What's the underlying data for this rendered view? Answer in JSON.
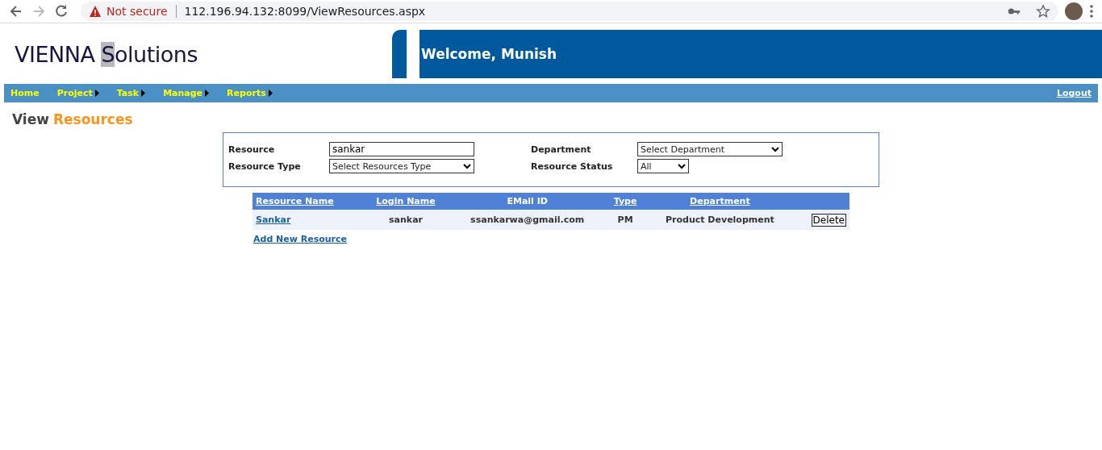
{
  "browser": {
    "security": "Not secure",
    "url": "112.196.94.132:8099/ViewResources.aspx",
    "forward_disabled": true
  },
  "logo": {
    "before": "VIENNA ",
    "marked": "S",
    "after": "olutions"
  },
  "welcome": "Welcome, Munish",
  "nav": [
    {
      "label": "Home",
      "has_submenu": false
    },
    {
      "label": "Project",
      "has_submenu": true
    },
    {
      "label": "Task",
      "has_submenu": true
    },
    {
      "label": "Manage",
      "has_submenu": true
    },
    {
      "label": "Reports",
      "has_submenu": true
    }
  ],
  "logout": "Logout",
  "page_title": {
    "first": "View",
    "second": "Resources"
  },
  "filters": [
    {
      "label": "Resource",
      "kind": "text",
      "value": "sankar"
    },
    {
      "label": "Department",
      "kind": "select",
      "value": "Select Department",
      "wide": true
    },
    {
      "label": "Resource Type",
      "kind": "select",
      "value": "Select Resources Type",
      "wide": true
    },
    {
      "label": "Resource Status",
      "kind": "select",
      "value": "All",
      "wide": false
    }
  ],
  "table": {
    "columns": [
      {
        "label": "Resource Name",
        "sortable": true
      },
      {
        "label": "Login Name",
        "sortable": true
      },
      {
        "label": "EMail ID",
        "sortable": false
      },
      {
        "label": "Type",
        "sortable": true
      },
      {
        "label": "Department",
        "sortable": true
      }
    ],
    "rows": [
      {
        "cells": [
          "Sankar",
          "sankar",
          "ssankarwa@gmail.com",
          "PM",
          "Product Development"
        ],
        "action": "Delete"
      }
    ]
  },
  "add_link": "Add New Resource"
}
